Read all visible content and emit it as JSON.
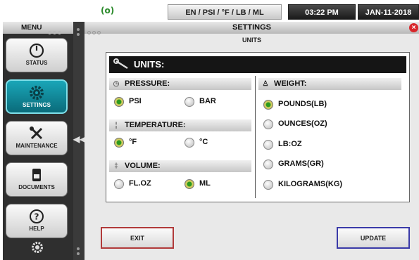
{
  "status_bar": {
    "signal_text": "(o)",
    "units_label": "EN / PSI / °F / LB / ML",
    "time": "03:22 PM",
    "date": "JAN-11-2018"
  },
  "menu": {
    "title": "MENU",
    "items": [
      {
        "label": "STATUS",
        "icon": "gauge-icon",
        "active": false
      },
      {
        "label": "SETTINGS",
        "icon": "gear-icon",
        "active": true
      },
      {
        "label": "MAINTENANCE",
        "icon": "tools-icon",
        "active": false
      },
      {
        "label": "DOCUMENTS",
        "icon": "document-icon",
        "active": false
      },
      {
        "label": "HELP",
        "icon": "help-icon",
        "active": false
      }
    ],
    "collapse_arrow": "◀◀"
  },
  "window": {
    "title": "SETTINGS",
    "close_glyph": "×",
    "subtitle": "UNITS"
  },
  "units": {
    "header": "UNITS:",
    "pressure": {
      "label": "PRESSURE:",
      "options": [
        {
          "label": "PSI",
          "selected": true
        },
        {
          "label": "BAR",
          "selected": false
        }
      ]
    },
    "temperature": {
      "label": "TEMPERATURE:",
      "options": [
        {
          "label": "°F",
          "selected": true
        },
        {
          "label": "°C",
          "selected": false
        }
      ]
    },
    "volume": {
      "label": "VOLUME:",
      "options": [
        {
          "label": "FL.OZ",
          "selected": false
        },
        {
          "label": "ML",
          "selected": true
        }
      ]
    },
    "weight": {
      "label": "WEIGHT:",
      "options": [
        {
          "label": "POUNDS(LB)",
          "selected": true
        },
        {
          "label": "OUNCES(OZ)",
          "selected": false
        },
        {
          "label": "LB:OZ",
          "selected": false
        },
        {
          "label": "GRAMS(GR)",
          "selected": false
        },
        {
          "label": "KILOGRAMS(KG)",
          "selected": false
        }
      ]
    }
  },
  "buttons": {
    "exit": "EXIT",
    "update": "UPDATE"
  },
  "colors": {
    "accent_active": "#1aa6b8",
    "radio_selected": "#2b9a1e",
    "exit_border": "#b13a3a",
    "update_border": "#3a3aa8",
    "close_red": "#d8262b"
  }
}
